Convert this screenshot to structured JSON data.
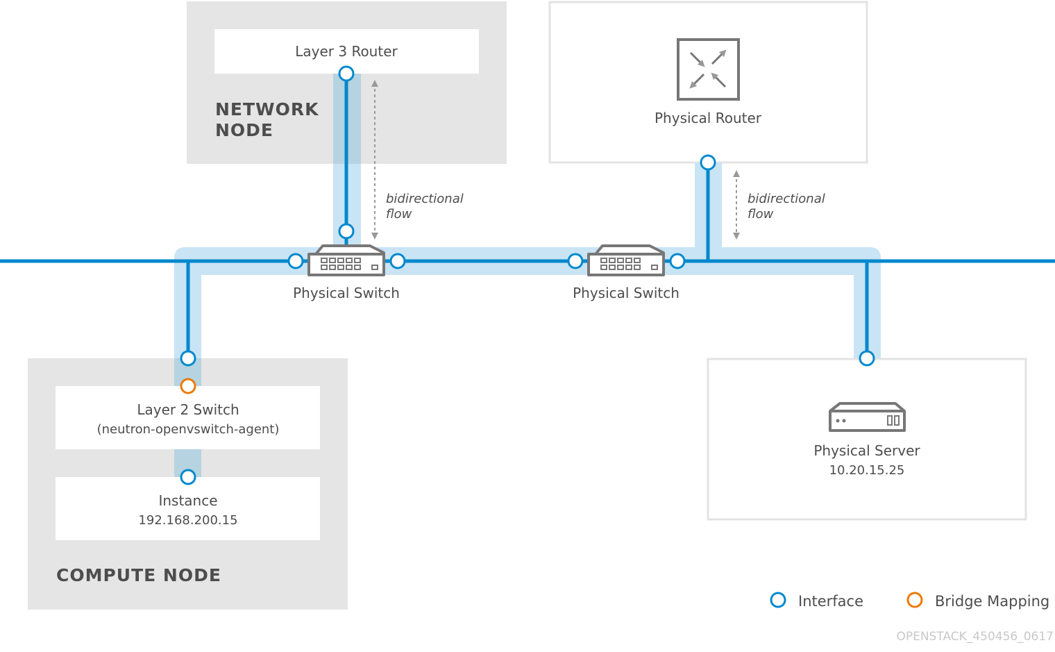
{
  "network_node": {
    "title_line1": "NETWORK",
    "title_line2": "NODE",
    "router_label": "Layer 3 Router"
  },
  "flow_label": {
    "line1": "bidirectional",
    "line2": "flow"
  },
  "physical_router": {
    "label": "Physical Router",
    "icon": "router-icon"
  },
  "switches": [
    {
      "label": "Physical Switch",
      "icon": "switch-icon"
    },
    {
      "label": "Physical Switch",
      "icon": "switch-icon"
    }
  ],
  "compute_node": {
    "title": "COMPUTE NODE",
    "l2_label": "Layer 2 Switch",
    "l2_sub": "(neutron-openvswitch-agent)",
    "instance_label": "Instance",
    "instance_ip": "192.168.200.15"
  },
  "physical_server": {
    "label": "Physical Server",
    "ip": "10.20.15.25",
    "icon": "server-icon"
  },
  "legend": {
    "interface": "Interface",
    "bridge_mapping": "Bridge Mapping"
  },
  "watermark": "OPENSTACK_450456_0617",
  "colors": {
    "interface": "#0088ce",
    "bridge_mapping": "#ec7a08",
    "network_line": "#0088ce",
    "band": "#c9e4f4",
    "node_box": "#e5e5e5"
  }
}
